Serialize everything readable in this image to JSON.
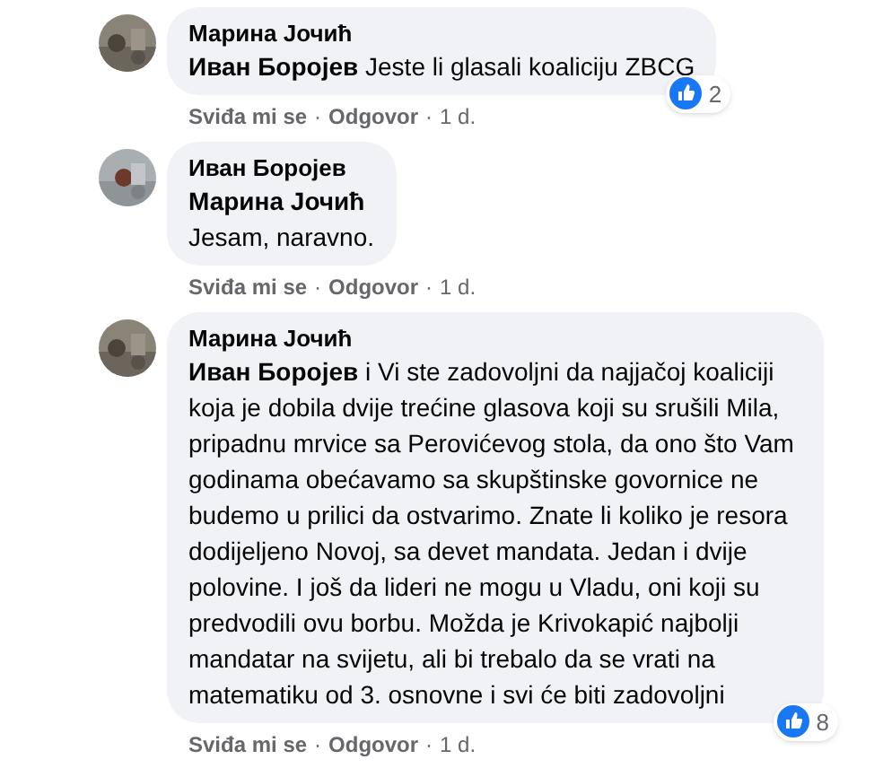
{
  "comments": [
    {
      "author": "Марина Јочић",
      "avatar": {
        "kind": "picture"
      },
      "paragraphs": [
        "**Иван Боројев** Jeste li glasali koaliciju ZBCG"
      ],
      "reaction": {
        "count": "2"
      },
      "actions": [
        {
          "kind": "link",
          "label": "Sviđa mi se"
        },
        {
          "kind": "separator",
          "label": "·"
        },
        {
          "kind": "link",
          "label": "Odgovor"
        },
        {
          "kind": "separator",
          "label": "·"
        },
        {
          "kind": "time",
          "label": "1 d."
        }
      ]
    },
    {
      "author": "Иван Боројев",
      "avatar": {
        "kind": "picture"
      },
      "paragraphs": [
        "**Марина Јочић**",
        "Jesam, naravno."
      ],
      "actions": [
        {
          "kind": "link",
          "label": "Sviđa mi se"
        },
        {
          "kind": "separator",
          "label": "·"
        },
        {
          "kind": "link",
          "label": "Odgovor"
        },
        {
          "kind": "separator",
          "label": "·"
        },
        {
          "kind": "time",
          "label": "1 d."
        }
      ]
    },
    {
      "author": "Марина Јочић",
      "avatar": {
        "kind": "picture"
      },
      "paragraphs": [
        "**Иван Боројев** i Vi ste zadovoljni da najjačoj koaliciji koja je dobila dvije trećine glasova koji su srušili Mila, pripadnu mrvice sa Perovićevog stola, da ono što Vam godinama obećavamo sa skupštinske govornice ne budemo u prilici da ostvarimo. Znate li koliko je resora dodijeljeno Novoj, sa devet mandata. Jedan i dvije polovine. I još da lideri ne mogu u Vladu, oni koji su predvodili ovu borbu. Možda je Krivokapić najbolji mandatar na svijetu, ali bi trebalo da se vrati na matematiku od 3. osnovne i svi će biti zadovoljni"
      ],
      "reaction": {
        "count": "8"
      },
      "actions": [
        {
          "kind": "link",
          "label": "Sviđa mi se"
        },
        {
          "kind": "separator",
          "label": "·"
        },
        {
          "kind": "link",
          "label": "Odgovor"
        },
        {
          "kind": "separator",
          "label": "·"
        },
        {
          "kind": "time",
          "label": "1 d."
        }
      ]
    }
  ]
}
